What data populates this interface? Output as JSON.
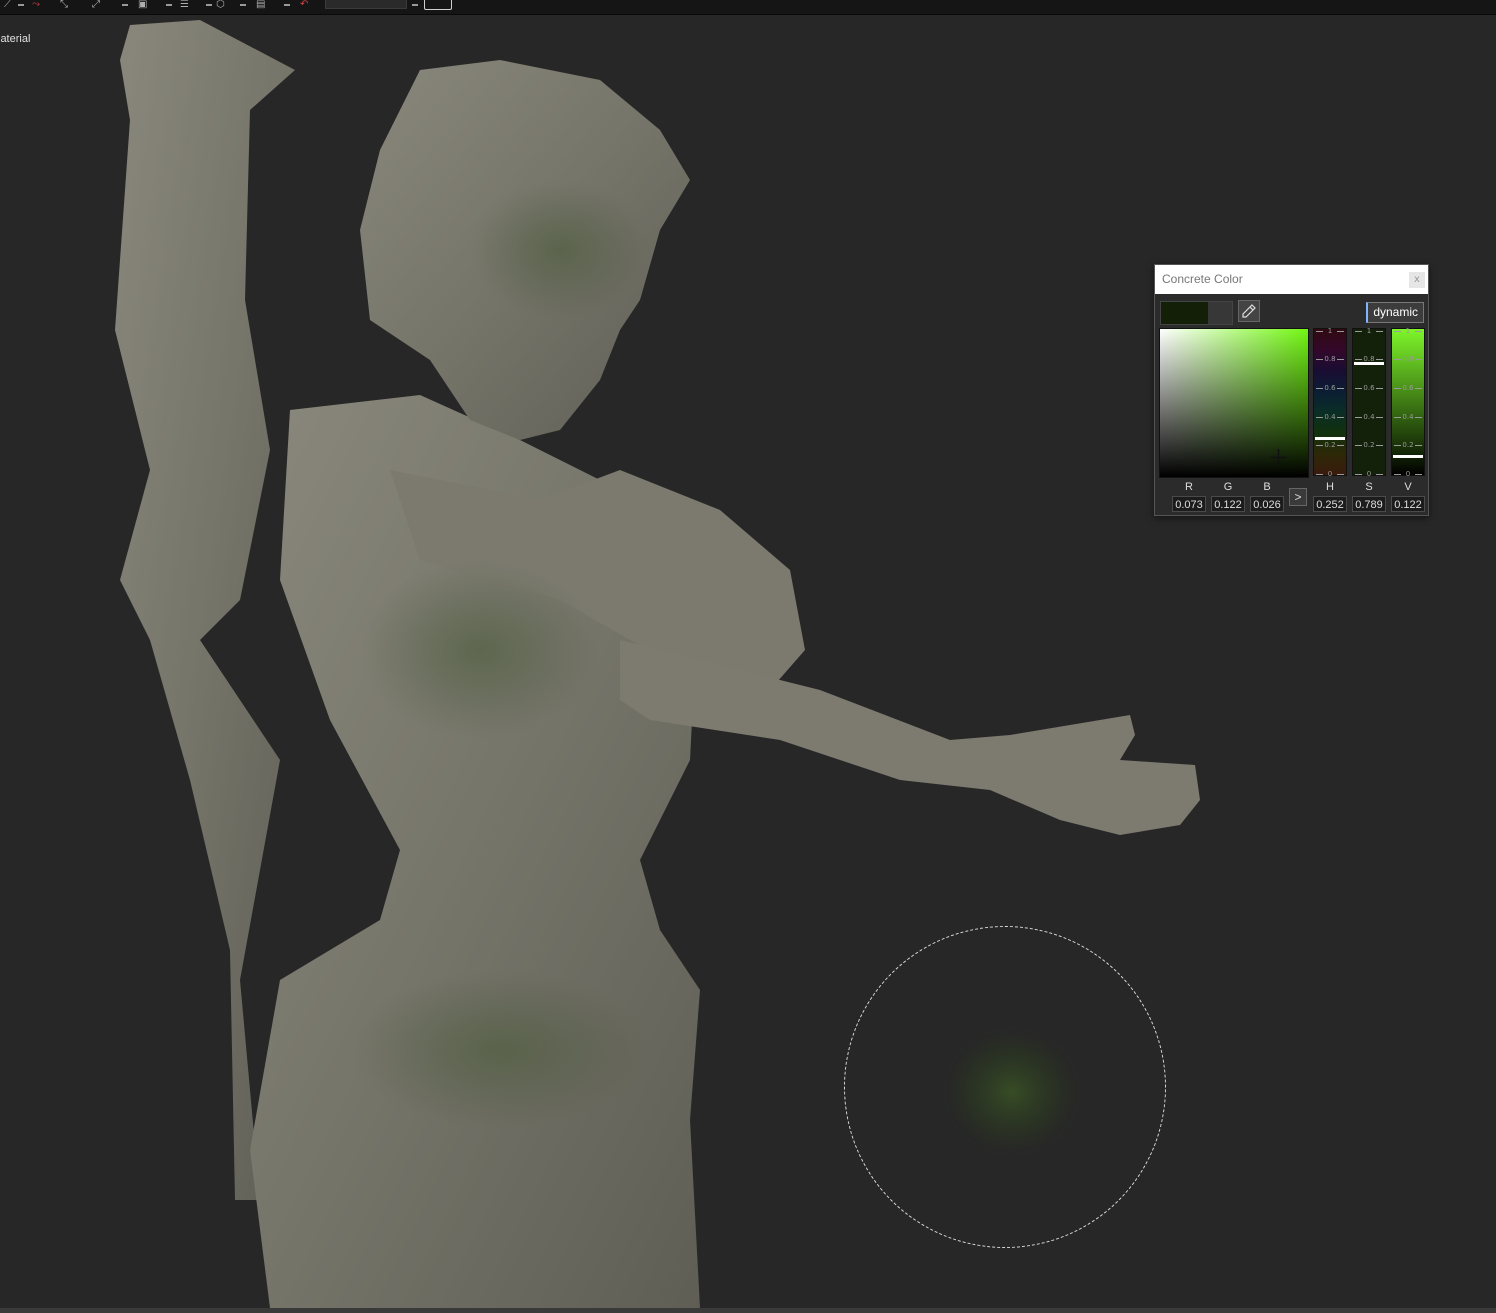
{
  "viewport": {
    "label": "laterial"
  },
  "color_picker": {
    "title": "Concrete Color",
    "close_label": "x",
    "mode_label": "dynamic",
    "current_color": "#131f07",
    "previous_color": "#373737",
    "arrow_label": ">",
    "rgb": [
      {
        "label": "R",
        "value": "0.073"
      },
      {
        "label": "G",
        "value": "0.122"
      },
      {
        "label": "B",
        "value": "0.026"
      }
    ],
    "hsv": [
      {
        "label": "H",
        "value": "0.252"
      },
      {
        "label": "S",
        "value": "0.789"
      },
      {
        "label": "V",
        "value": "0.122"
      }
    ],
    "ticks": [
      "1",
      "0.8",
      "0.6",
      "0.4",
      "0.2",
      "0"
    ],
    "levels": {
      "h": 0.252,
      "s": 0.789,
      "v": 0.122
    }
  },
  "colors": {
    "background": "#272727",
    "hue_accent": "#73f712",
    "toolbar": "#151515"
  }
}
